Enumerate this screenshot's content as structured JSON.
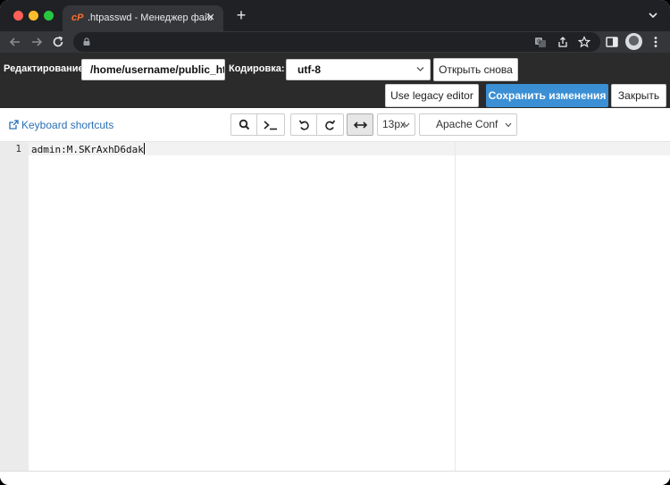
{
  "browser": {
    "tab_title": ".htpasswd - Менеджер файлов",
    "favicon_text": "cP",
    "address": ""
  },
  "editor_header": {
    "edit_label": "Редактирование:",
    "path_value": "/home/username/public_html/.htpasswd",
    "encoding_label": "Кодировка:",
    "encoding_value": "utf-8",
    "reopen_label": "Открыть снова",
    "legacy_label": "Use legacy editor",
    "save_label": "Сохранить изменения",
    "close_label": "Закрыть"
  },
  "editor_toolbar": {
    "shortcuts_label": "Keyboard shortcuts",
    "font_size": "13px",
    "mode": "Apache Conf"
  },
  "code": {
    "lines": [
      {
        "number": "1",
        "text": "admin:M.SKrAxhD6dak"
      }
    ]
  },
  "colors": {
    "primary_button": "#3b8fd4",
    "link": "#2a6fb5",
    "header_bg": "#2b2b2b"
  }
}
